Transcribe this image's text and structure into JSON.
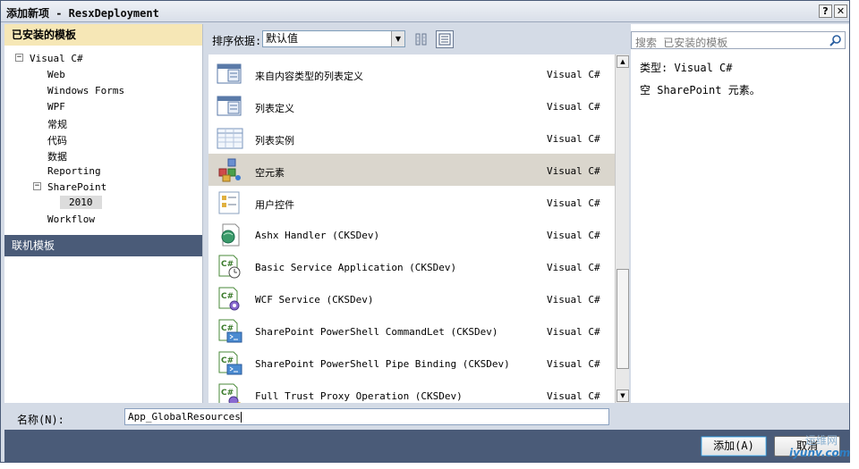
{
  "window": {
    "title": "添加新项 - ResxDeployment",
    "help_glyph": "?",
    "close_glyph": "✕"
  },
  "left_panel": {
    "installed_header": "已安装的模板",
    "online_header": "联机模板",
    "tree": {
      "visual_csharp": "Visual C#",
      "visual_csharp_toggle": "−",
      "web": "Web",
      "windows_forms": "Windows Forms",
      "wpf": "WPF",
      "general": "常规",
      "code": "代码",
      "data": "数据",
      "reporting": "Reporting",
      "sharepoint": "SharePoint",
      "sharepoint_toggle": "−",
      "sp2010": "2010",
      "workflow": "Workflow"
    }
  },
  "toolbar": {
    "sort_label": "排序依据:",
    "sort_value": "默认值",
    "view_icons": [
      "small-icons-view-icon",
      "list-view-icon"
    ]
  },
  "templates": [
    {
      "name": "来自内容类型的列表定义",
      "lang": "Visual C#",
      "icon": "list-definition-icon",
      "selected": false
    },
    {
      "name": "列表定义",
      "lang": "Visual C#",
      "icon": "list-definition-icon",
      "selected": false
    },
    {
      "name": "列表实例",
      "lang": "Visual C#",
      "icon": "list-instance-icon",
      "selected": false
    },
    {
      "name": "空元素",
      "lang": "Visual C#",
      "icon": "empty-element-icon",
      "selected": true
    },
    {
      "name": "用户控件",
      "lang": "Visual C#",
      "icon": "user-control-icon",
      "selected": false
    },
    {
      "name": "Ashx Handler (CKSDev)",
      "lang": "Visual C#",
      "icon": "ashx-handler-icon",
      "selected": false
    },
    {
      "name": "Basic Service Application (CKSDev)",
      "lang": "Visual C#",
      "icon": "csharp-service-icon",
      "selected": false
    },
    {
      "name": "WCF Service (CKSDev)",
      "lang": "Visual C#",
      "icon": "csharp-wcf-icon",
      "selected": false
    },
    {
      "name": "SharePoint PowerShell CommandLet (CKSDev)",
      "lang": "Visual C#",
      "icon": "csharp-powershell-icon",
      "selected": false
    },
    {
      "name": "SharePoint PowerShell Pipe Binding (CKSDev)",
      "lang": "Visual C#",
      "icon": "csharp-powershell-icon",
      "selected": false
    },
    {
      "name": "Full Trust Proxy Operation (CKSDev)",
      "lang": "Visual C#",
      "icon": "csharp-proxy-icon",
      "selected": false
    }
  ],
  "scrollbar": {
    "up_glyph": "▲",
    "down_glyph": "▼"
  },
  "right_panel": {
    "search_placeholder": "搜索 已安装的模板",
    "type_line": "类型: Visual C#",
    "description": "空 SharePoint 元素。"
  },
  "name_field": {
    "label": "名称(N):",
    "value": "App_GlobalResources"
  },
  "buttons": {
    "add": "添加(A)",
    "cancel": "取消"
  },
  "watermark": {
    "line1": "运维网",
    "line2": "iyunv.com"
  },
  "colors": {
    "installed_header_bg": "#f6e7b6",
    "online_header_bg": "#4a5b78",
    "selected_row_bg": "#dad6cd",
    "footer_bg": "#4a5b78"
  }
}
